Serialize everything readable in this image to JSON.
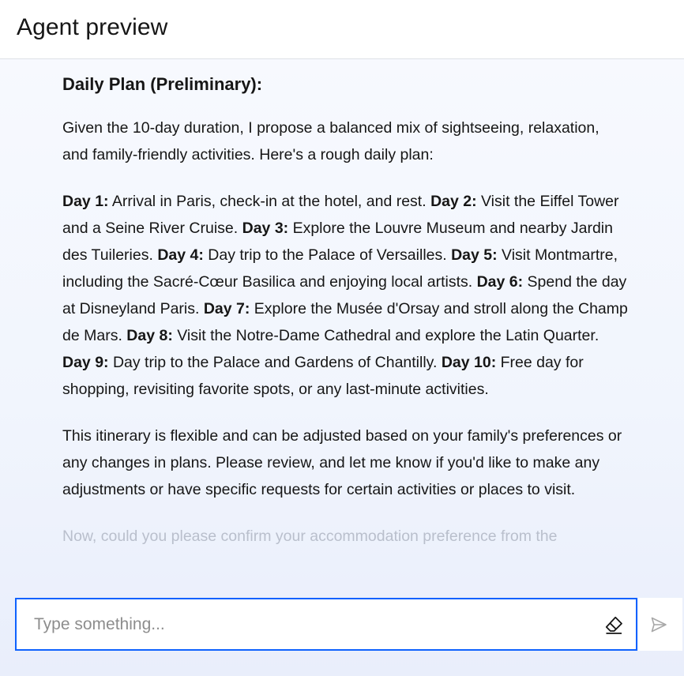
{
  "header": {
    "title": "Agent preview"
  },
  "message": {
    "heading": "Daily Plan (Preliminary):",
    "intro": "Given the 10-day duration, I propose a balanced mix of sightseeing, relaxation, and family-friendly activities. Here's a rough daily plan:",
    "days": [
      {
        "label": "Day 1:",
        "text": " Arrival in Paris, check-in at the hotel, and rest. "
      },
      {
        "label": "Day 2:",
        "text": " Visit the Eiffel Tower and a Seine River Cruise. "
      },
      {
        "label": "Day 3:",
        "text": " Explore the Louvre Museum and nearby Jardin des Tuileries. "
      },
      {
        "label": "Day 4:",
        "text": " Day trip to the Palace of Versailles. "
      },
      {
        "label": "Day 5:",
        "text": " Visit Montmartre, including the Sacré-Cœur Basilica and enjoying local artists. "
      },
      {
        "label": "Day 6:",
        "text": " Spend the day at Disneyland Paris. "
      },
      {
        "label": "Day 7:",
        "text": " Explore the Musée d'Orsay and stroll along the Champ de Mars. "
      },
      {
        "label": "Day 8:",
        "text": " Visit the Notre-Dame Cathedral and explore the Latin Quarter. "
      },
      {
        "label": "Day 9:",
        "text": " Day trip to the Palace and Gardens of Chantilly. "
      },
      {
        "label": "Day 10:",
        "text": " Free day for shopping, revisiting favorite spots, or any last-minute activities."
      }
    ],
    "closing": "This itinerary is flexible and can be adjusted based on your family's preferences or any changes in plans. Please review, and let me know if you'd like to make any adjustments or have specific requests for certain activities or places to visit.",
    "trailing": "Now, could you please confirm your accommodation preference from the"
  },
  "input": {
    "placeholder": "Type something...",
    "value": ""
  },
  "icons": {
    "clear": "eraser-icon",
    "send": "send-icon"
  },
  "colors": {
    "accent": "#0f62fe",
    "text": "#161616",
    "placeholder": "#8d8d8d"
  }
}
